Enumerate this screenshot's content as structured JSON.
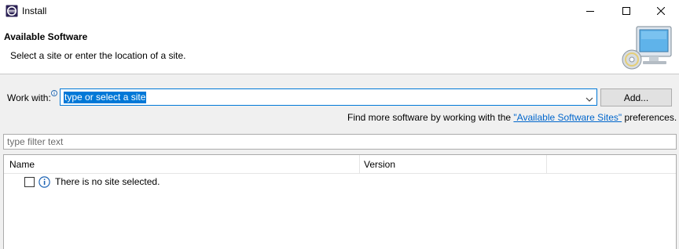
{
  "window": {
    "title": "Install",
    "app_icon": "eclipse-icon",
    "controls": {
      "minimize": "minimize-icon",
      "maximize": "maximize-icon",
      "close": "close-icon"
    }
  },
  "header": {
    "title": "Available Software",
    "subtitle": "Select a site or enter the location of a site.",
    "image": "computer-cd-icon"
  },
  "work_with": {
    "label": "Work with:",
    "value": "type or select a site",
    "add_button": "Add..."
  },
  "find_more": {
    "prefix": "Find more software by working with the ",
    "link": "\"Available Software Sites\"",
    "suffix": " preferences."
  },
  "filter": {
    "placeholder": "type filter text"
  },
  "table": {
    "columns": [
      "Name",
      "Version"
    ],
    "rows": [
      {
        "checked": false,
        "icon": "info-icon",
        "text": "There is no site selected."
      }
    ]
  },
  "colors": {
    "accent": "#0078d7",
    "link": "#0066cc",
    "background": "#f0f0f0"
  }
}
